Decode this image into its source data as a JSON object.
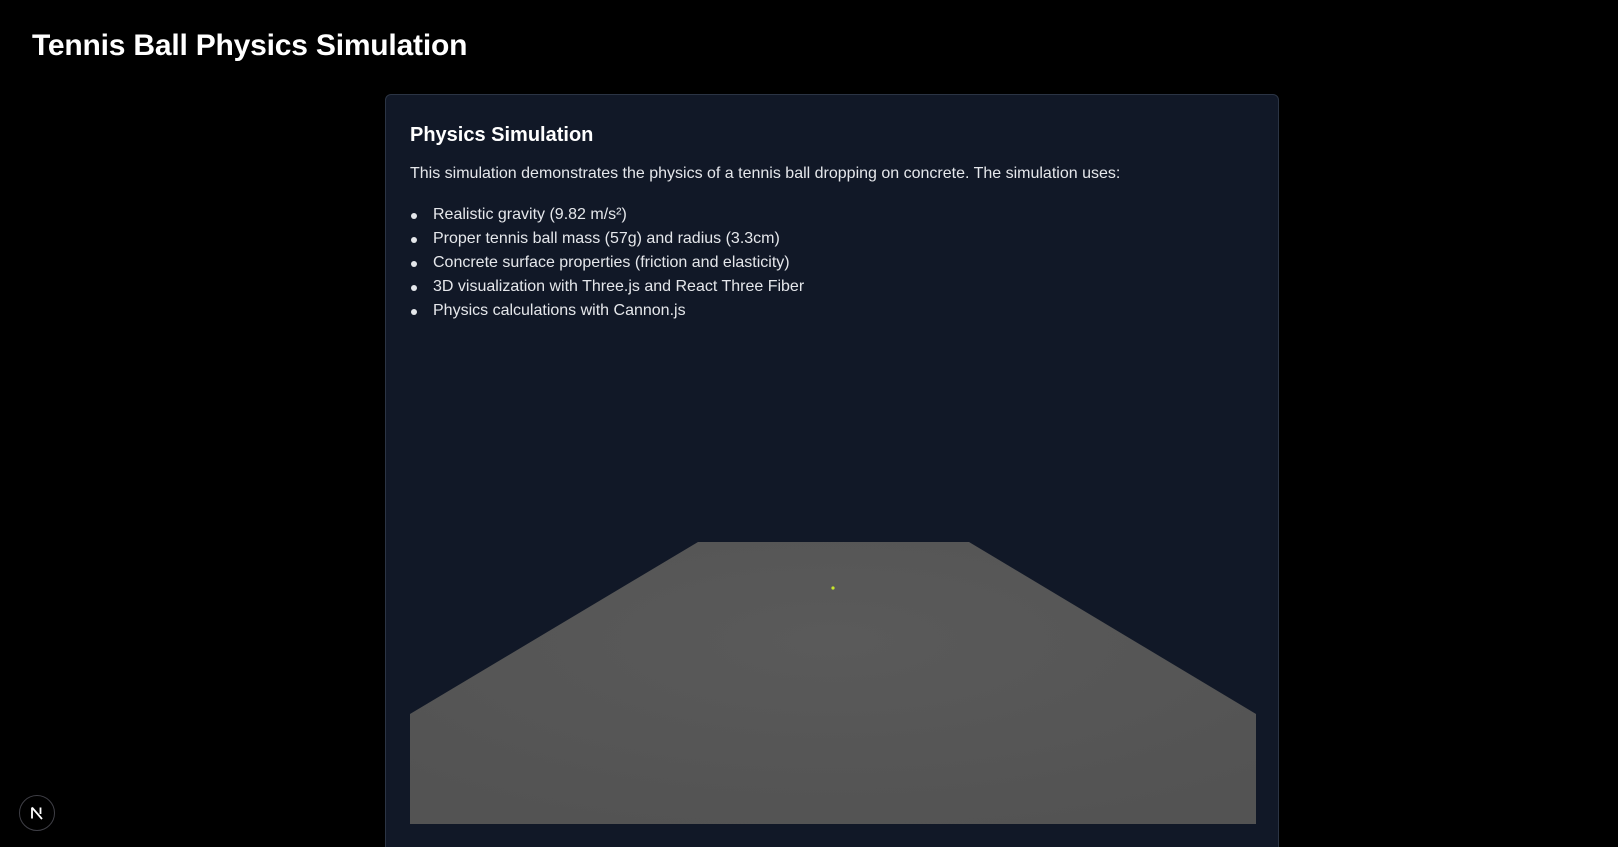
{
  "page": {
    "title": "Tennis Ball Physics Simulation"
  },
  "card": {
    "title": "Physics Simulation",
    "description": "This simulation demonstrates the physics of a tennis ball dropping on concrete. The simulation uses:",
    "features": [
      "Realistic gravity (9.82 m/s²)",
      "Proper tennis ball mass (57g) and radius (3.3cm)",
      "Concrete surface properties (friction and elasticity)",
      "3D visualization with Three.js and React Three Fiber",
      "Physics calculations with Cannon.js"
    ]
  },
  "scene": {
    "ground_color": "#555555",
    "background_color": "#111827",
    "ball_color": "#c8e62a"
  },
  "dev_badge": {
    "icon": "nextjs-logo-icon"
  }
}
